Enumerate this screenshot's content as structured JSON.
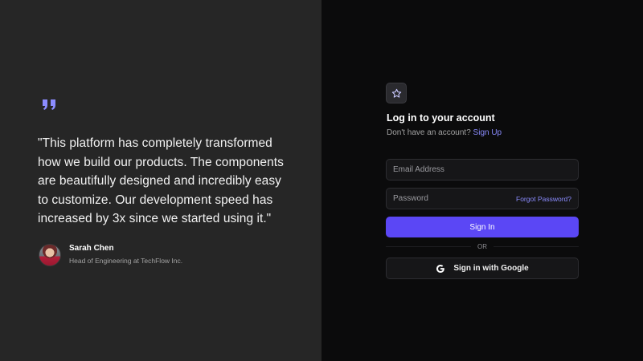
{
  "testimonial": {
    "quote": "\"This platform has completely transformed how we build our products. The components are beautifully designed and incredibly easy to customize. Our development speed has increased by 3x since we started using it.\"",
    "author_name": "Sarah Chen",
    "author_role": "Head of Engineering at TechFlow Inc."
  },
  "login": {
    "logo_icon": "star-icon",
    "title": "Log in to your account",
    "no_account_text": "Don't have an account?",
    "signup_link": "Sign Up",
    "email_placeholder": "Email Address",
    "password_placeholder": "Password",
    "forgot_password": "Forgot Password?",
    "signin_button": "Sign In",
    "divider_text": "OR",
    "google_button": "Sign in with Google"
  },
  "colors": {
    "accent": "#5b47f5",
    "link": "#8b8cff",
    "left_panel_bg": "#262626",
    "right_panel_bg": "#0b0b0c"
  }
}
